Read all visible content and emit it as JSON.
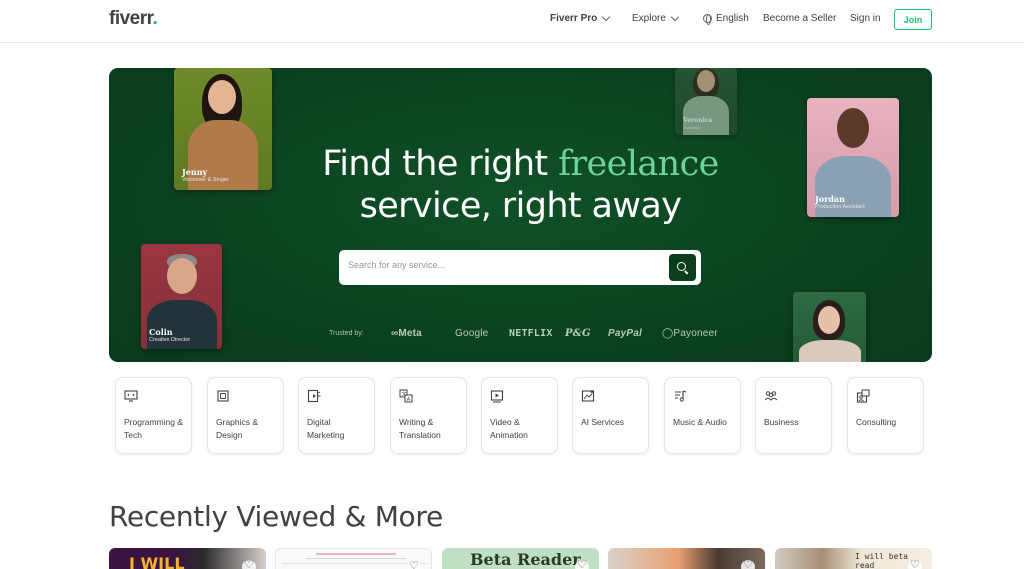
{
  "header": {
    "logo_text": "fiverr",
    "logo_dot": ".",
    "nav": {
      "fiverr_pro": "Fiverr Pro",
      "explore": "Explore",
      "language": "English",
      "become_seller": "Become a Seller",
      "sign_in": "Sign in",
      "join": "Join"
    }
  },
  "hero": {
    "line1_pre": "Find the right ",
    "line1_accent": "freelance",
    "line2": "service, right away",
    "search_placeholder": "Search for any service...",
    "trusted_label": "Trusted by:",
    "brands": [
      "∞Meta",
      "Google",
      "NETFLIX",
      "P&G",
      "PayPal",
      "◯Payoneer"
    ],
    "people": [
      {
        "name": "Jenny",
        "role": "Voiceover & Singer"
      },
      {
        "name": "Veronica",
        "role": "Translator"
      },
      {
        "name": "Jordan",
        "role": "Production Assistant"
      },
      {
        "name": "Colin",
        "role": "Creative Director"
      }
    ],
    "colors": {
      "background": "#0b4120",
      "accent": "#6fd49a"
    }
  },
  "categories": [
    {
      "label": "Programming & Tech",
      "icon": "monitor-code-icon"
    },
    {
      "label": "Graphics & Design",
      "icon": "graphics-frame-icon"
    },
    {
      "label": "Digital Marketing",
      "icon": "digital-marketing-icon"
    },
    {
      "label": "Writing & Translation",
      "icon": "translation-icon"
    },
    {
      "label": "Video & Animation",
      "icon": "video-play-icon"
    },
    {
      "label": "AI Services",
      "icon": "ai-sparkle-icon"
    },
    {
      "label": "Music & Audio",
      "icon": "music-note-icon"
    },
    {
      "label": "Business",
      "icon": "business-people-icon"
    },
    {
      "label": "Consulting",
      "icon": "consulting-icon"
    }
  ],
  "recently_viewed": {
    "title": "Recently Viewed & More",
    "thumb_texts": [
      "I WILL",
      "Beta Reader",
      "I will beta read"
    ]
  }
}
